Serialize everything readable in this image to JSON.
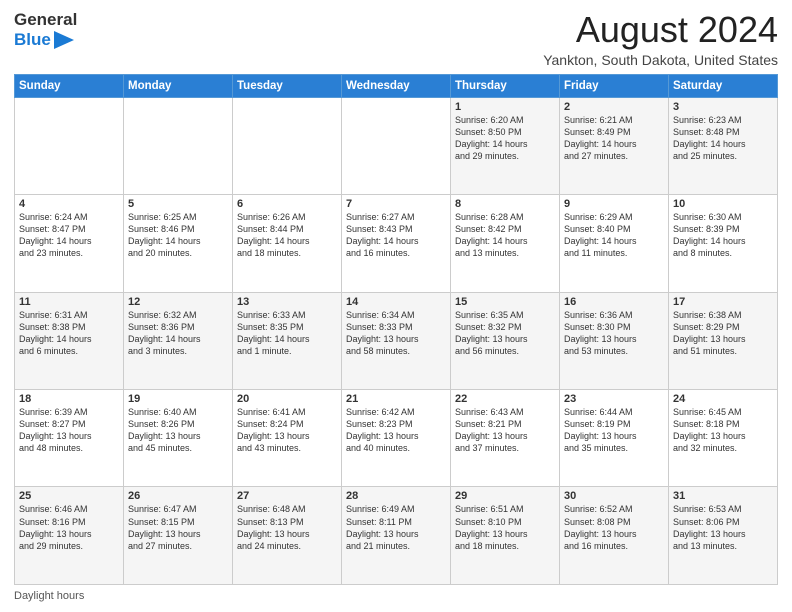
{
  "header": {
    "logo_general": "General",
    "logo_blue": "Blue",
    "month_title": "August 2024",
    "location": "Yankton, South Dakota, United States"
  },
  "calendar": {
    "days_of_week": [
      "Sunday",
      "Monday",
      "Tuesday",
      "Wednesday",
      "Thursday",
      "Friday",
      "Saturday"
    ],
    "weeks": [
      [
        {
          "day": "",
          "info": ""
        },
        {
          "day": "",
          "info": ""
        },
        {
          "day": "",
          "info": ""
        },
        {
          "day": "",
          "info": ""
        },
        {
          "day": "1",
          "info": "Sunrise: 6:20 AM\nSunset: 8:50 PM\nDaylight: 14 hours\nand 29 minutes."
        },
        {
          "day": "2",
          "info": "Sunrise: 6:21 AM\nSunset: 8:49 PM\nDaylight: 14 hours\nand 27 minutes."
        },
        {
          "day": "3",
          "info": "Sunrise: 6:23 AM\nSunset: 8:48 PM\nDaylight: 14 hours\nand 25 minutes."
        }
      ],
      [
        {
          "day": "4",
          "info": "Sunrise: 6:24 AM\nSunset: 8:47 PM\nDaylight: 14 hours\nand 23 minutes."
        },
        {
          "day": "5",
          "info": "Sunrise: 6:25 AM\nSunset: 8:46 PM\nDaylight: 14 hours\nand 20 minutes."
        },
        {
          "day": "6",
          "info": "Sunrise: 6:26 AM\nSunset: 8:44 PM\nDaylight: 14 hours\nand 18 minutes."
        },
        {
          "day": "7",
          "info": "Sunrise: 6:27 AM\nSunset: 8:43 PM\nDaylight: 14 hours\nand 16 minutes."
        },
        {
          "day": "8",
          "info": "Sunrise: 6:28 AM\nSunset: 8:42 PM\nDaylight: 14 hours\nand 13 minutes."
        },
        {
          "day": "9",
          "info": "Sunrise: 6:29 AM\nSunset: 8:40 PM\nDaylight: 14 hours\nand 11 minutes."
        },
        {
          "day": "10",
          "info": "Sunrise: 6:30 AM\nSunset: 8:39 PM\nDaylight: 14 hours\nand 8 minutes."
        }
      ],
      [
        {
          "day": "11",
          "info": "Sunrise: 6:31 AM\nSunset: 8:38 PM\nDaylight: 14 hours\nand 6 minutes."
        },
        {
          "day": "12",
          "info": "Sunrise: 6:32 AM\nSunset: 8:36 PM\nDaylight: 14 hours\nand 3 minutes."
        },
        {
          "day": "13",
          "info": "Sunrise: 6:33 AM\nSunset: 8:35 PM\nDaylight: 14 hours\nand 1 minute."
        },
        {
          "day": "14",
          "info": "Sunrise: 6:34 AM\nSunset: 8:33 PM\nDaylight: 13 hours\nand 58 minutes."
        },
        {
          "day": "15",
          "info": "Sunrise: 6:35 AM\nSunset: 8:32 PM\nDaylight: 13 hours\nand 56 minutes."
        },
        {
          "day": "16",
          "info": "Sunrise: 6:36 AM\nSunset: 8:30 PM\nDaylight: 13 hours\nand 53 minutes."
        },
        {
          "day": "17",
          "info": "Sunrise: 6:38 AM\nSunset: 8:29 PM\nDaylight: 13 hours\nand 51 minutes."
        }
      ],
      [
        {
          "day": "18",
          "info": "Sunrise: 6:39 AM\nSunset: 8:27 PM\nDaylight: 13 hours\nand 48 minutes."
        },
        {
          "day": "19",
          "info": "Sunrise: 6:40 AM\nSunset: 8:26 PM\nDaylight: 13 hours\nand 45 minutes."
        },
        {
          "day": "20",
          "info": "Sunrise: 6:41 AM\nSunset: 8:24 PM\nDaylight: 13 hours\nand 43 minutes."
        },
        {
          "day": "21",
          "info": "Sunrise: 6:42 AM\nSunset: 8:23 PM\nDaylight: 13 hours\nand 40 minutes."
        },
        {
          "day": "22",
          "info": "Sunrise: 6:43 AM\nSunset: 8:21 PM\nDaylight: 13 hours\nand 37 minutes."
        },
        {
          "day": "23",
          "info": "Sunrise: 6:44 AM\nSunset: 8:19 PM\nDaylight: 13 hours\nand 35 minutes."
        },
        {
          "day": "24",
          "info": "Sunrise: 6:45 AM\nSunset: 8:18 PM\nDaylight: 13 hours\nand 32 minutes."
        }
      ],
      [
        {
          "day": "25",
          "info": "Sunrise: 6:46 AM\nSunset: 8:16 PM\nDaylight: 13 hours\nand 29 minutes."
        },
        {
          "day": "26",
          "info": "Sunrise: 6:47 AM\nSunset: 8:15 PM\nDaylight: 13 hours\nand 27 minutes."
        },
        {
          "day": "27",
          "info": "Sunrise: 6:48 AM\nSunset: 8:13 PM\nDaylight: 13 hours\nand 24 minutes."
        },
        {
          "day": "28",
          "info": "Sunrise: 6:49 AM\nSunset: 8:11 PM\nDaylight: 13 hours\nand 21 minutes."
        },
        {
          "day": "29",
          "info": "Sunrise: 6:51 AM\nSunset: 8:10 PM\nDaylight: 13 hours\nand 18 minutes."
        },
        {
          "day": "30",
          "info": "Sunrise: 6:52 AM\nSunset: 8:08 PM\nDaylight: 13 hours\nand 16 minutes."
        },
        {
          "day": "31",
          "info": "Sunrise: 6:53 AM\nSunset: 8:06 PM\nDaylight: 13 hours\nand 13 minutes."
        }
      ]
    ]
  },
  "footer": {
    "daylight_label": "Daylight hours"
  }
}
